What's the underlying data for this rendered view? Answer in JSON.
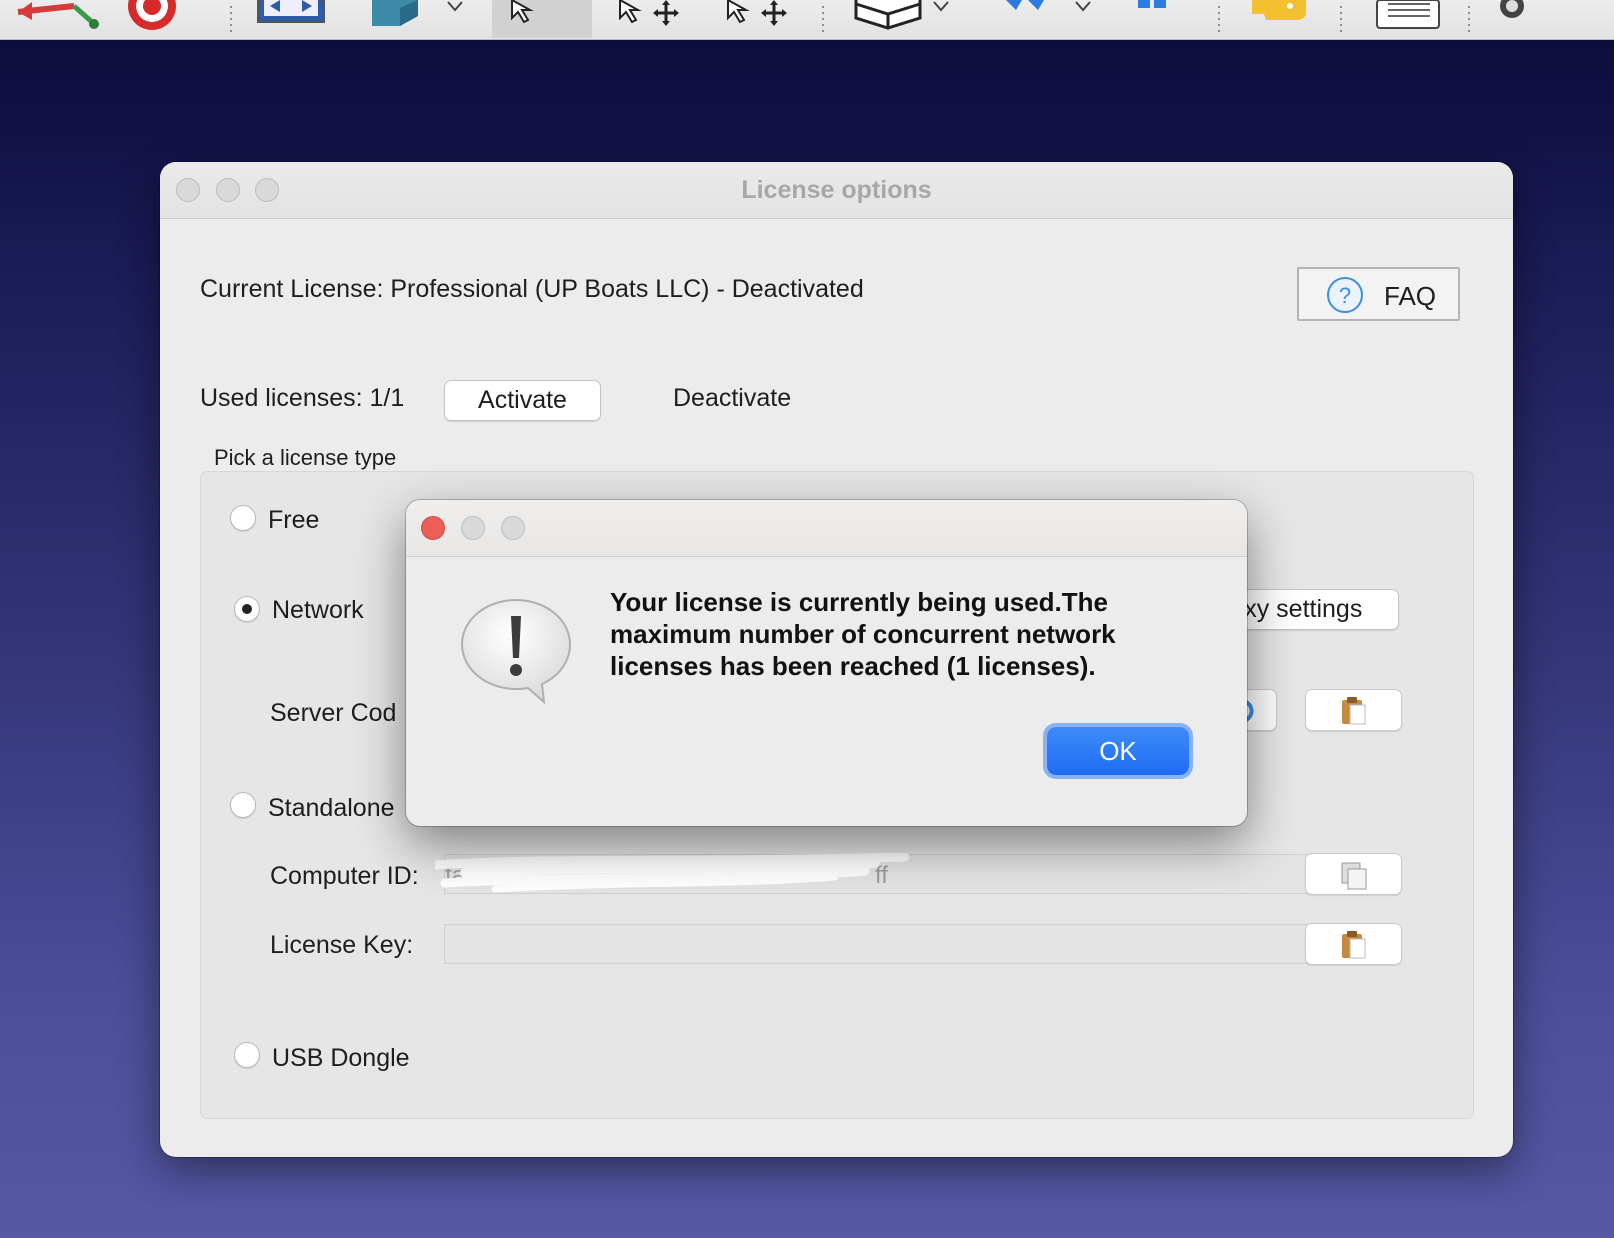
{
  "toolbar": {
    "icons": [
      "measure-arrow-icon",
      "target-icon",
      "fit-view-icon",
      "cube-view-icon",
      "select-cursor-icon",
      "move-cursor-icon",
      "move-cursor-2-icon",
      "box-view-icon",
      "blue-arrow-icon",
      "grid-icon",
      "python-icon",
      "report-icon",
      "gear-icon"
    ]
  },
  "license_window": {
    "title": "License options",
    "current_license": "Current License: Professional (UP Boats LLC) - Deactivated",
    "faq_label": "FAQ",
    "used_licenses": "Used licenses: 1/1",
    "activate_label": "Activate",
    "deactivate_label": "Deactivate",
    "group_title": "Pick a license type",
    "options": {
      "free": "Free",
      "network": "Network",
      "standalone": "Standalone",
      "usb": "USB Dongle"
    },
    "selected_option": "Network",
    "proxy_settings_label": "roxy settings",
    "server_code_label": "Server Cod",
    "computer_id_label": "Computer ID:",
    "computer_id_value": "fa",
    "computer_id_tail": "ff",
    "license_key_label": "License Key:",
    "license_key_value": ""
  },
  "alert": {
    "message": "Your license is currently being used.The maximum number of concurrent network licenses has been reached (1 licenses).",
    "ok_label": "OK",
    "icon": "exclamation-bubble-icon"
  },
  "colors": {
    "accent": "#1f6cf3",
    "close_red": "#ec5f57",
    "desktop_top": "#0c0c3e",
    "desktop_bottom": "#5558a3"
  }
}
